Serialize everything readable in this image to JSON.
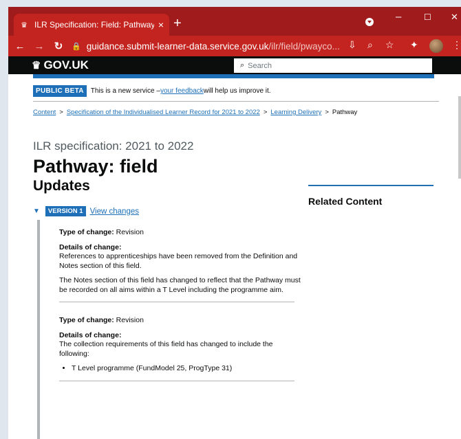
{
  "tab": {
    "title": "ILR Specification: Field: Pathway",
    "close": "×",
    "new": "+"
  },
  "window_controls": {
    "minimize": "–",
    "maximize": "☐",
    "close": "✕"
  },
  "toolbar": {
    "back": "←",
    "forward": "→",
    "reload": "↻",
    "url_host": "guidance.submit-learner-data.service.gov.uk",
    "url_path": "/ilr/field/pwayco...",
    "icons": [
      "install-icon",
      "zoom-icon",
      "star-icon",
      "extensions-icon"
    ]
  },
  "gov": {
    "logo": "GOV.UK",
    "search_placeholder": "Search"
  },
  "beta": {
    "tag": "PUBLIC BETA",
    "text_before": "This is a new service – ",
    "link": "your feedback",
    "text_after": " will help us improve it."
  },
  "breadcrumbs": [
    {
      "label": "Content",
      "link": true
    },
    {
      "label": "Specification of the Individualised Learner Record for 2021 to 2022",
      "link": true
    },
    {
      "label": "Learning Delivery",
      "link": true
    },
    {
      "label": "Pathway",
      "link": false
    }
  ],
  "caption": "ILR specification: 2021 to 2022",
  "title": "Pathway: field",
  "updates_heading": "Updates",
  "related_heading": "Related Content",
  "version": {
    "tag": "VERSION 1",
    "link": "View changes"
  },
  "changes": [
    {
      "type_label": "Type of change:",
      "type_value": "Revision",
      "details_label": "Details of change:",
      "paragraphs": [
        "References to apprenticeships have been removed from the Definition and Notes section of this field.",
        "The Notes section of this field has changed to reflect that the Pathway must be recorded on all aims within a T Level including the programme aim."
      ]
    },
    {
      "type_label": "Type of change:",
      "type_value": "Revision",
      "details_label": "Details of change:",
      "paragraphs": [
        "The collection requirements of this field has changed to include the following:"
      ],
      "bullets": [
        "T Level programme (FundModel 25, ProgType 31)"
      ]
    }
  ]
}
